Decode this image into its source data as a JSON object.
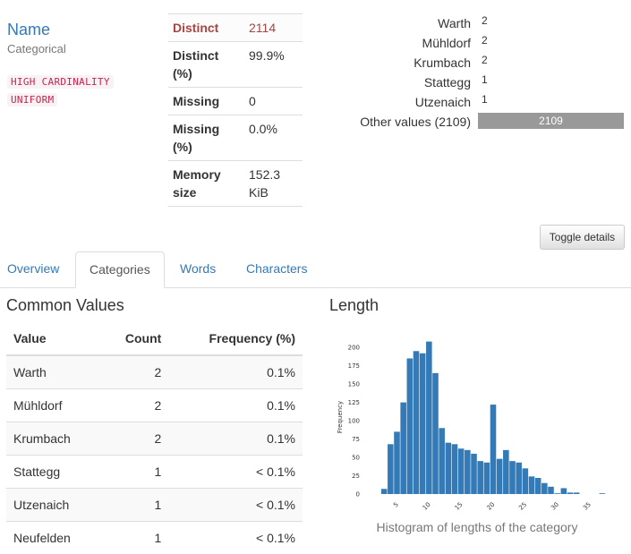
{
  "variable": {
    "name": "Name",
    "type": "Categorical",
    "badges": [
      "HIGH CARDINALITY",
      "UNIFORM"
    ]
  },
  "stats": [
    {
      "key": "Distinct",
      "value": "2114",
      "alert": true
    },
    {
      "key": "Distinct (%)",
      "value": "99.9%",
      "alert": false
    },
    {
      "key": "Missing",
      "value": "0",
      "alert": false
    },
    {
      "key": "Missing (%)",
      "value": "0.0%",
      "alert": false
    },
    {
      "key": "Memory size",
      "value": "152.3 KiB",
      "alert": false
    }
  ],
  "mini_freq": [
    {
      "label": "Warth",
      "count": "2"
    },
    {
      "label": "Mühldorf",
      "count": "2"
    },
    {
      "label": "Krumbach",
      "count": "2"
    },
    {
      "label": "Stattegg",
      "count": "1"
    },
    {
      "label": "Utzenaich",
      "count": "1"
    },
    {
      "label": "Other values (2109)",
      "count": "2109",
      "bar": true
    }
  ],
  "toggle_label": "Toggle details",
  "tabs": [
    "Overview",
    "Categories",
    "Words",
    "Characters"
  ],
  "active_tab": "Categories",
  "common_values": {
    "title": "Common Values",
    "headers": [
      "Value",
      "Count",
      "Frequency (%)"
    ],
    "rows": [
      [
        "Warth",
        "2",
        "0.1%"
      ],
      [
        "Mühldorf",
        "2",
        "0.1%"
      ],
      [
        "Krumbach",
        "2",
        "0.1%"
      ],
      [
        "Stattegg",
        "1",
        "< 0.1%"
      ],
      [
        "Utzenaich",
        "1",
        "< 0.1%"
      ],
      [
        "Neufelden",
        "1",
        "< 0.1%"
      ]
    ]
  },
  "length": {
    "title": "Length",
    "caption": "Histogram of lengths of the category"
  },
  "colors": {
    "link": "#337ab7",
    "bar": "#337ab7",
    "alert": "#a94442",
    "badge": "#c7254e"
  },
  "chart_data": {
    "type": "bar",
    "title": "",
    "xlabel": "",
    "ylabel": "Frequency",
    "xlim": [
      2,
      38
    ],
    "ylim": [
      0,
      210
    ],
    "yticks": [
      0,
      25,
      50,
      75,
      100,
      125,
      150,
      175,
      200
    ],
    "xticks": [
      5,
      10,
      15,
      20,
      25,
      30,
      35
    ],
    "bin_width": 1,
    "bins": [
      3,
      4,
      5,
      6,
      7,
      8,
      9,
      10,
      11,
      12,
      13,
      14,
      15,
      16,
      17,
      18,
      19,
      20,
      21,
      22,
      23,
      24,
      25,
      26,
      27,
      28,
      29,
      30,
      31,
      32,
      33,
      34,
      35,
      36,
      37
    ],
    "values": [
      7,
      68,
      85,
      125,
      185,
      195,
      192,
      208,
      165,
      90,
      70,
      68,
      62,
      60,
      55,
      45,
      43,
      122,
      48,
      60,
      45,
      43,
      35,
      24,
      22,
      15,
      10,
      1,
      8,
      2,
      2,
      0,
      0,
      0,
      1
    ]
  }
}
